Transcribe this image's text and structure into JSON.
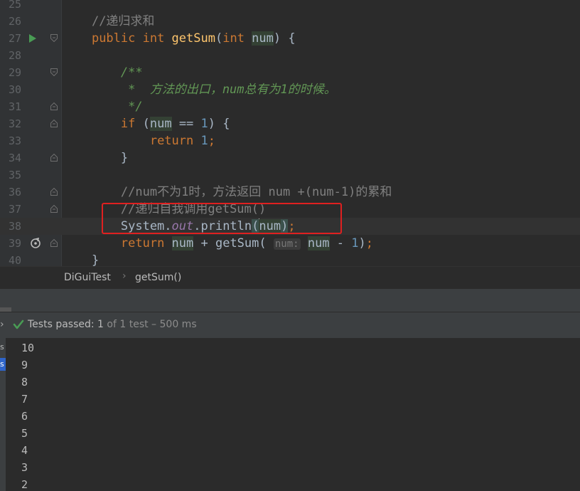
{
  "editor": {
    "lines": [
      {
        "n": "25",
        "html": ""
      },
      {
        "n": "26",
        "html": "    <span class=\"cm\">//递归求和</span>"
      },
      {
        "n": "27",
        "html": "    <span class=\"kw\">public int </span><span class=\"fn\">getSum</span>(<span class=\"kw\">int </span><span class=\"var\">num</span>) {"
      },
      {
        "n": "28",
        "html": ""
      },
      {
        "n": "29",
        "html": "        <span class=\"dc\">/**</span>"
      },
      {
        "n": "30",
        "html": "<span class=\"dc\">         *  方法的出口，num总有为1的时候。</span>"
      },
      {
        "n": "31",
        "html": "<span class=\"dc\">         */</span>"
      },
      {
        "n": "32",
        "html": "        <span class=\"kw\">if </span>(<span class=\"var\">num</span> == <span class=\"num\">1</span>) {"
      },
      {
        "n": "33",
        "html": "            <span class=\"kw\">return </span><span class=\"num\">1</span><span class=\"kw\">;</span>"
      },
      {
        "n": "34",
        "html": "        }"
      },
      {
        "n": "35",
        "html": ""
      },
      {
        "n": "36",
        "html": "        <span class=\"cm\">//num不为1时，方法返回 num +(num-1)的累和</span>"
      },
      {
        "n": "37",
        "html": "        <span class=\"cm\">//递归自我调用getSum()</span>"
      },
      {
        "n": "38",
        "html": "        System.<span class=\"fld\">out</span>.println<span class=\"brace-hl\">(</span><span class=\"caret\"></span><span class=\"var\">num</span><span class=\"brace-hl\">)</span><span class=\"kw\">;</span>"
      },
      {
        "n": "39",
        "html": "        <span class=\"kw\">return </span><span class=\"var\">num</span> + getSum( <span class=\"hint\">num:</span> <span class=\"var\">num</span> - <span class=\"num\">1</span>)<span class=\"kw\">;</span>"
      },
      {
        "n": "40",
        "html": "    }"
      }
    ]
  },
  "breadcrumb": {
    "class_name": "DiGuiTest",
    "separator": "›",
    "method": "getSum()"
  },
  "test_status": {
    "passed_label": "Tests passed: ",
    "passed_count": "1",
    "total": " of 1 test – 500 ms"
  },
  "console": {
    "tabs": [
      "s",
      "s"
    ],
    "output": [
      "10",
      "9",
      "8",
      "7",
      "6",
      "5",
      "4",
      "3",
      "2"
    ]
  },
  "colors": {
    "keyword": "#cc7832",
    "function": "#ffc66d",
    "number": "#6897bb",
    "comment": "#808080",
    "doc": "#629755",
    "field": "#9876aa",
    "highlight_box": "#e02020",
    "pass": "#499c54"
  }
}
